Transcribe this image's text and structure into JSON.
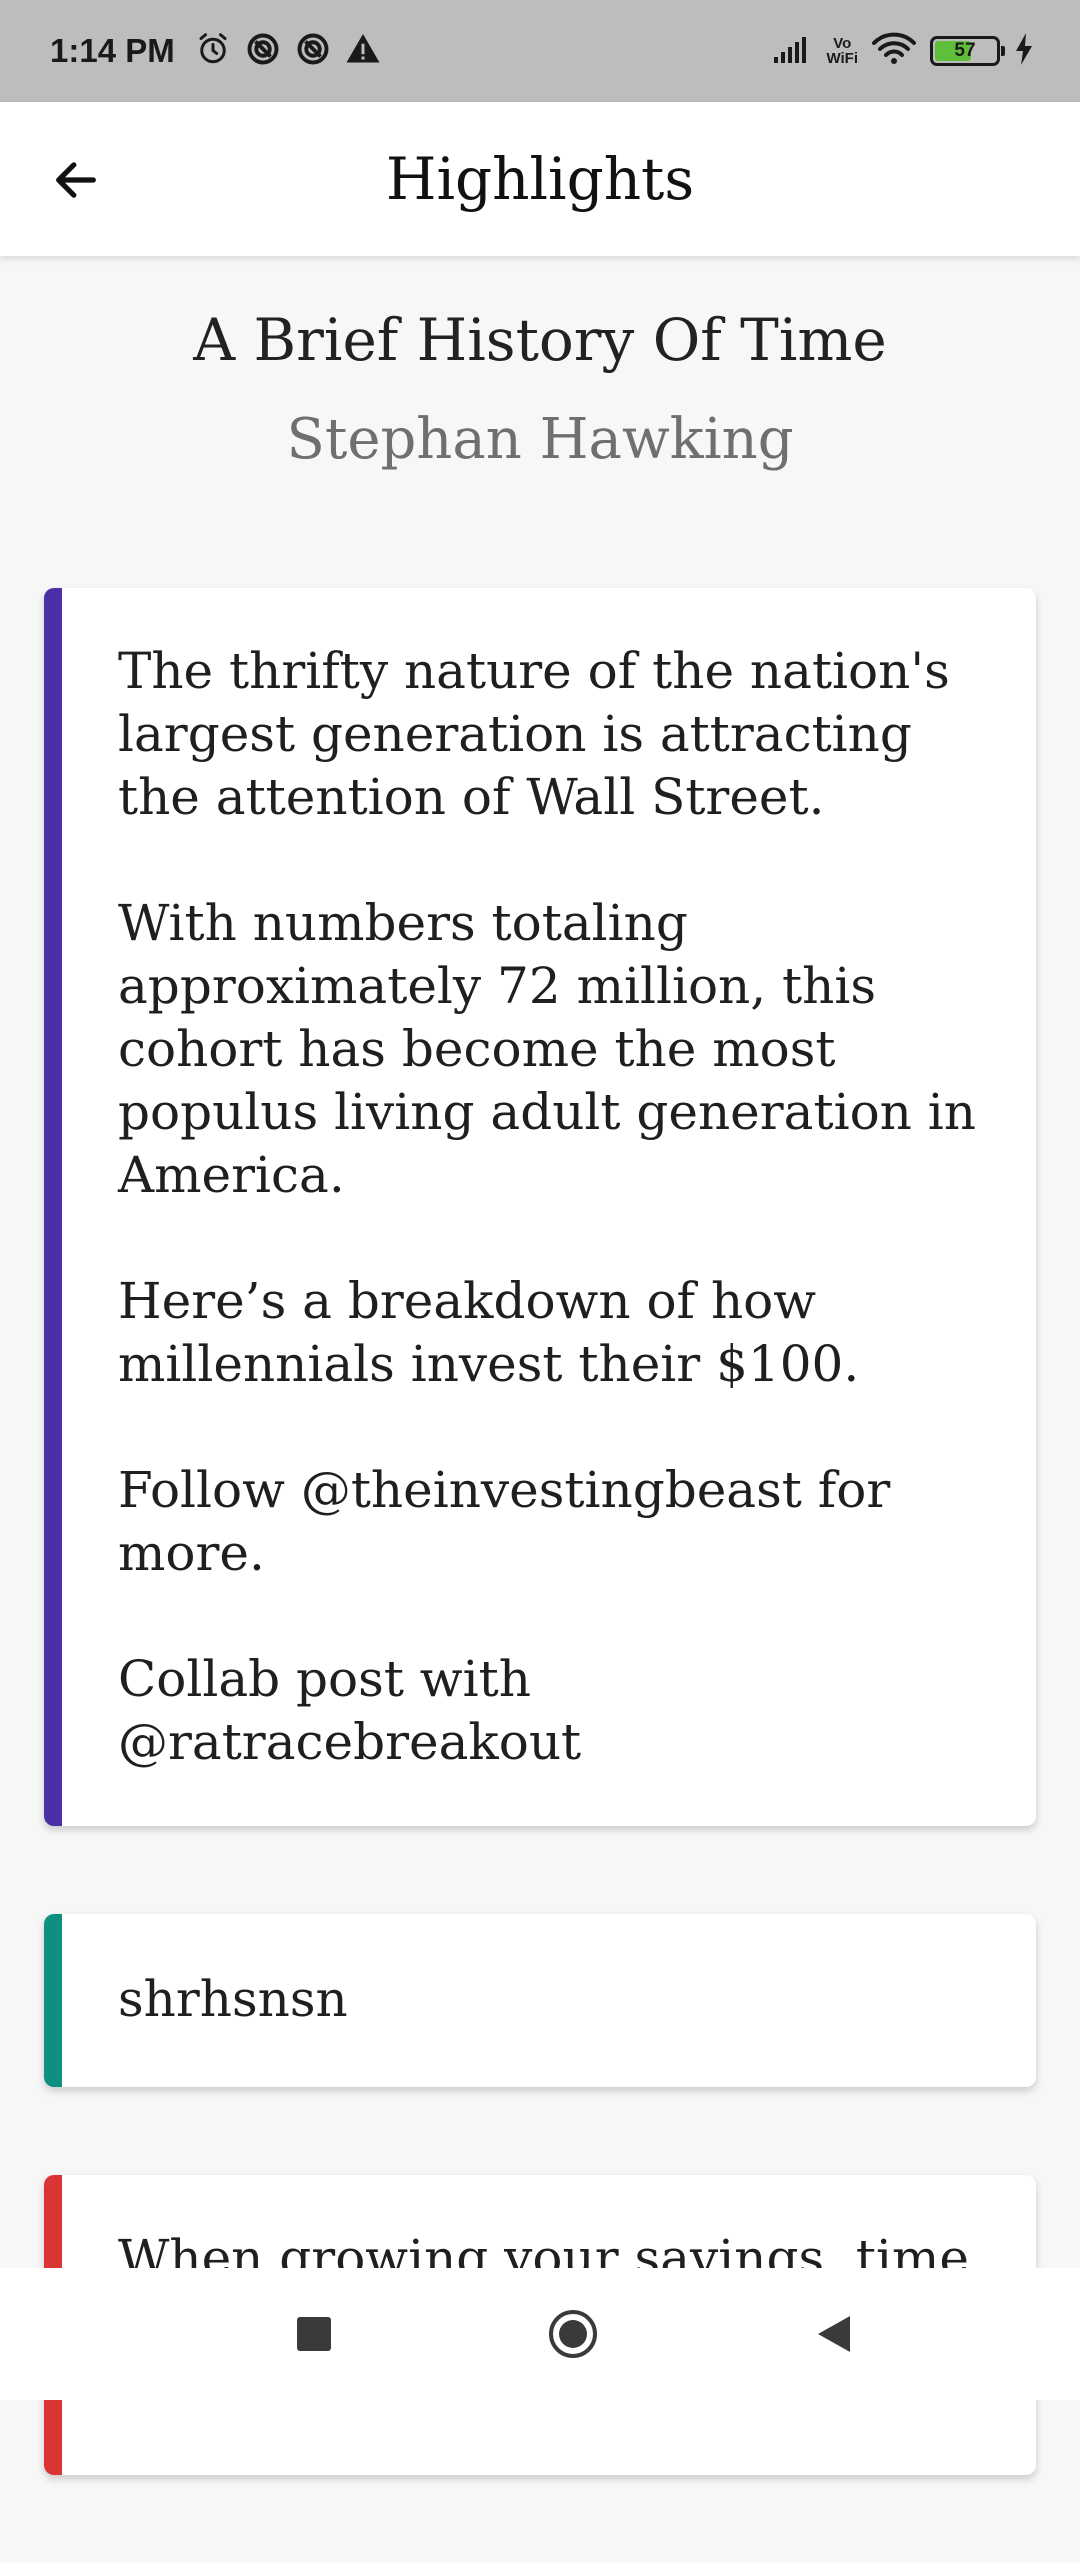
{
  "status_bar": {
    "time": "1:14 PM",
    "left_icons": [
      "alarm-icon",
      "data-saver-icon",
      "data-saver-icon",
      "warning-icon"
    ],
    "volte": "Vo\nWiFi",
    "battery_level": "57",
    "battery_percent": 57,
    "battery_color": "#5fbf3a"
  },
  "app_bar": {
    "title": "Highlights",
    "back_icon": "arrow-left-icon"
  },
  "book": {
    "title": "A Brief History Of Time",
    "author": "Stephan Hawking"
  },
  "highlights": [
    {
      "color": "#4b2fa6",
      "text": "The thrifty nature of the nation's largest generation is attracting the attention of Wall Street.\n\nWith numbers totaling approximately 72 million, this cohort has become the most populus living adult generation in America.\n\nHere’s a breakdown of how millennials invest their $100.\n\nFollow @theinvestingbeast for more.\n\nCollab post with @ratracebreakout"
    },
    {
      "color": "#0f8f80",
      "text": "shrhsnsn"
    },
    {
      "color": "#d93535",
      "text": "When growing your savings, time is your friend. The longer you can"
    }
  ],
  "nav_bar": {
    "recents_icon": "square-icon",
    "home_icon": "circle-home-icon",
    "back_icon": "triangle-back-icon"
  }
}
